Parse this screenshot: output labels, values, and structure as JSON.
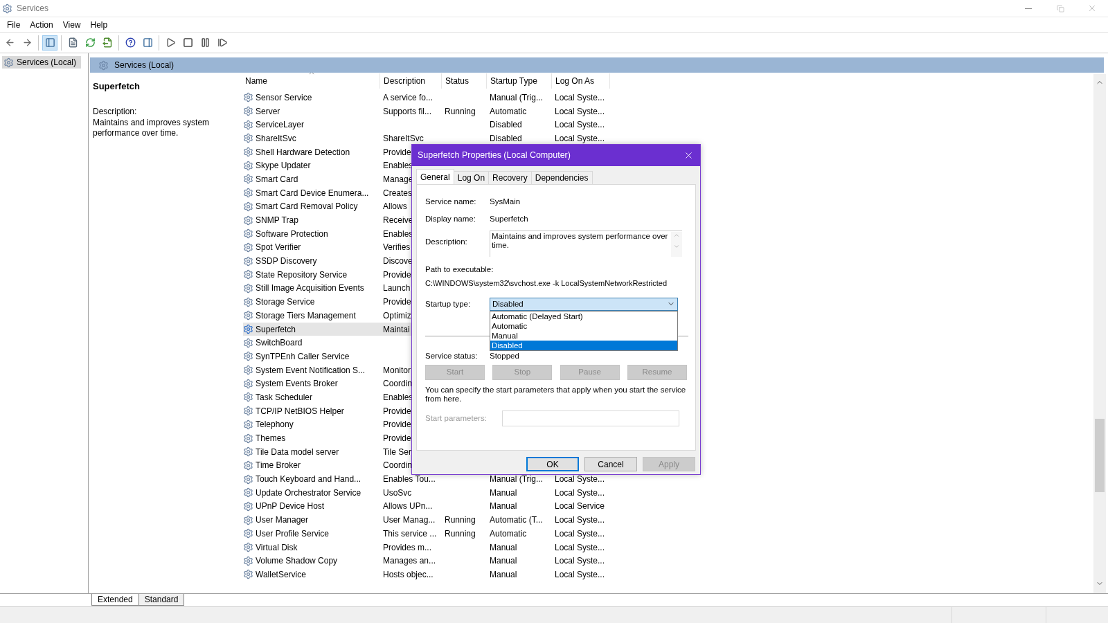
{
  "window": {
    "title": "Services"
  },
  "menu": [
    "File",
    "Action",
    "View",
    "Help"
  ],
  "toolbar": [
    {
      "kind": "back",
      "selected": false
    },
    {
      "kind": "forward",
      "selected": false
    },
    {
      "kind": "tree",
      "selected": true
    },
    {
      "kind": "properties",
      "selected": false
    },
    {
      "kind": "refresh",
      "selected": false
    },
    {
      "kind": "export",
      "selected": false
    },
    {
      "kind": "help",
      "selected": false
    },
    {
      "kind": "action_pane",
      "selected": false
    },
    {
      "kind": "start",
      "selected": false
    },
    {
      "kind": "stop",
      "selected": false
    },
    {
      "kind": "pause",
      "selected": false
    },
    {
      "kind": "resume",
      "selected": false
    }
  ],
  "tree": [
    {
      "label": "Services (Local)",
      "selected": true
    }
  ],
  "panel": {
    "title": "Services (Local)",
    "service_name": "Superfetch",
    "description_label": "Description:",
    "description": "Maintains and improves system performance over time."
  },
  "table": {
    "columns": [
      {
        "label": "Name",
        "sorted": true
      },
      {
        "label": "Description",
        "sorted": false
      },
      {
        "label": "Status",
        "sorted": false
      },
      {
        "label": "Startup Type",
        "sorted": false
      },
      {
        "label": "Log On As",
        "sorted": false
      }
    ],
    "rows": [
      {
        "name": "Sensor Service",
        "description": "A service fo...",
        "startup_type": "Manual (Trig...",
        "log_on_as": "Local Syste...",
        "selected": false
      },
      {
        "name": "Server",
        "description": "Supports fil...",
        "status": "Running",
        "startup_type": "Automatic",
        "log_on_as": "Local Syste...",
        "selected": false
      },
      {
        "name": "ServiceLayer",
        "startup_type": "Disabled",
        "log_on_as": "Local Syste...",
        "selected": false
      },
      {
        "name": "ShareItSvc",
        "description": "ShareItSvc",
        "startup_type": "Disabled",
        "log_on_as": "Local Syste...",
        "selected": false
      },
      {
        "name": "Shell Hardware Detection",
        "description": "Provide",
        "selected": false
      },
      {
        "name": "Skype Updater",
        "description": "Enables",
        "selected": false
      },
      {
        "name": "Smart Card",
        "description": "Manage",
        "selected": false
      },
      {
        "name": "Smart Card Device Enumera...",
        "description": "Creates",
        "selected": false
      },
      {
        "name": "Smart Card Removal Policy",
        "description": "Allows",
        "selected": false
      },
      {
        "name": "SNMP Trap",
        "description": "Receive",
        "selected": false
      },
      {
        "name": "Software Protection",
        "description": "Enables",
        "selected": false
      },
      {
        "name": "Spot Verifier",
        "description": "Verifies",
        "selected": false
      },
      {
        "name": "SSDP Discovery",
        "description": "Discove",
        "selected": false
      },
      {
        "name": "State Repository Service",
        "description": "Provide",
        "selected": false
      },
      {
        "name": "Still Image Acquisition Events",
        "description": "Launch",
        "selected": false
      },
      {
        "name": "Storage Service",
        "description": "Provide",
        "selected": false
      },
      {
        "name": "Storage Tiers Management",
        "description": "Optimiz",
        "selected": false
      },
      {
        "name": "Superfetch",
        "description": "Maintai",
        "selected": true
      },
      {
        "name": "SwitchBoard",
        "selected": false
      },
      {
        "name": "SynTPEnh Caller Service",
        "selected": false
      },
      {
        "name": "System Event Notification S...",
        "description": "Monitor",
        "selected": false
      },
      {
        "name": "System Events Broker",
        "description": "Coordin",
        "selected": false
      },
      {
        "name": "Task Scheduler",
        "description": "Enables",
        "selected": false
      },
      {
        "name": "TCP/IP NetBIOS Helper",
        "description": "Provide",
        "selected": false
      },
      {
        "name": "Telephony",
        "description": "Provide",
        "selected": false
      },
      {
        "name": "Themes",
        "description": "Provide",
        "selected": false
      },
      {
        "name": "Tile Data model server",
        "description": "Tile Ser",
        "selected": false
      },
      {
        "name": "Time Broker",
        "description": "Coordin",
        "selected": false
      },
      {
        "name": "Touch Keyboard and Hand...",
        "description": "Enables Tou...",
        "startup_type": "Manual (Trig...",
        "log_on_as": "Local Syste...",
        "selected": false
      },
      {
        "name": "Update Orchestrator Service",
        "description": "UsoSvc",
        "startup_type": "Manual",
        "log_on_as": "Local Syste...",
        "selected": false
      },
      {
        "name": "UPnP Device Host",
        "description": "Allows UPn...",
        "startup_type": "Manual",
        "log_on_as": "Local Service",
        "selected": false
      },
      {
        "name": "User Manager",
        "description": "User Manag...",
        "status": "Running",
        "startup_type": "Automatic (T...",
        "log_on_as": "Local Syste...",
        "selected": false
      },
      {
        "name": "User Profile Service",
        "description": "This service ...",
        "status": "Running",
        "startup_type": "Automatic",
        "log_on_as": "Local Syste...",
        "selected": false
      },
      {
        "name": "Virtual Disk",
        "description": "Provides m...",
        "startup_type": "Manual",
        "log_on_as": "Local Syste...",
        "selected": false
      },
      {
        "name": "Volume Shadow Copy",
        "description": "Manages an...",
        "startup_type": "Manual",
        "log_on_as": "Local Syste...",
        "selected": false
      },
      {
        "name": "WalletService",
        "description": "Hosts objec...",
        "startup_type": "Manual",
        "log_on_as": "Local Syste...",
        "selected": false
      }
    ]
  },
  "view_tabs": [
    {
      "label": "Extended",
      "selected": true
    },
    {
      "label": "Standard",
      "selected": false
    }
  ],
  "dialog": {
    "title": "Superfetch Properties (Local Computer)",
    "tabs": [
      {
        "label": "General",
        "selected": true
      },
      {
        "label": "Log On",
        "selected": false
      },
      {
        "label": "Recovery",
        "selected": false
      },
      {
        "label": "Dependencies",
        "selected": false
      }
    ],
    "fields": [
      {
        "label": "Service name:",
        "value": "SysMain"
      },
      {
        "label": "Display name:",
        "value": "Superfetch"
      }
    ],
    "description": {
      "label": "Description:",
      "value": "Maintains and improves system performance over time."
    },
    "path": {
      "label": "Path to executable:",
      "value": "C:\\WINDOWS\\system32\\svchost.exe -k LocalSystemNetworkRestricted"
    },
    "startup": {
      "label": "Startup type:",
      "value": "Disabled",
      "expanded": true,
      "options": [
        {
          "label": "Automatic (Delayed Start)",
          "selected": false
        },
        {
          "label": "Automatic",
          "selected": false
        },
        {
          "label": "Manual",
          "selected": false
        },
        {
          "label": "Disabled",
          "selected": true
        }
      ]
    },
    "status": {
      "label": "Service status:",
      "value": "Stopped"
    },
    "service_buttons": [
      {
        "label": "Start",
        "disabled": true
      },
      {
        "label": "Stop",
        "disabled": true
      },
      {
        "label": "Pause",
        "disabled": true
      },
      {
        "label": "Resume",
        "disabled": true
      }
    ],
    "hint": "You can specify the start parameters that apply when you start the service from here.",
    "params": {
      "label": "Start parameters:",
      "disabled": true
    },
    "buttons": [
      {
        "label": "OK",
        "default": true,
        "disabled": false
      },
      {
        "label": "Cancel",
        "default": false,
        "disabled": false
      },
      {
        "label": "Apply",
        "default": false,
        "disabled": true
      }
    ]
  }
}
